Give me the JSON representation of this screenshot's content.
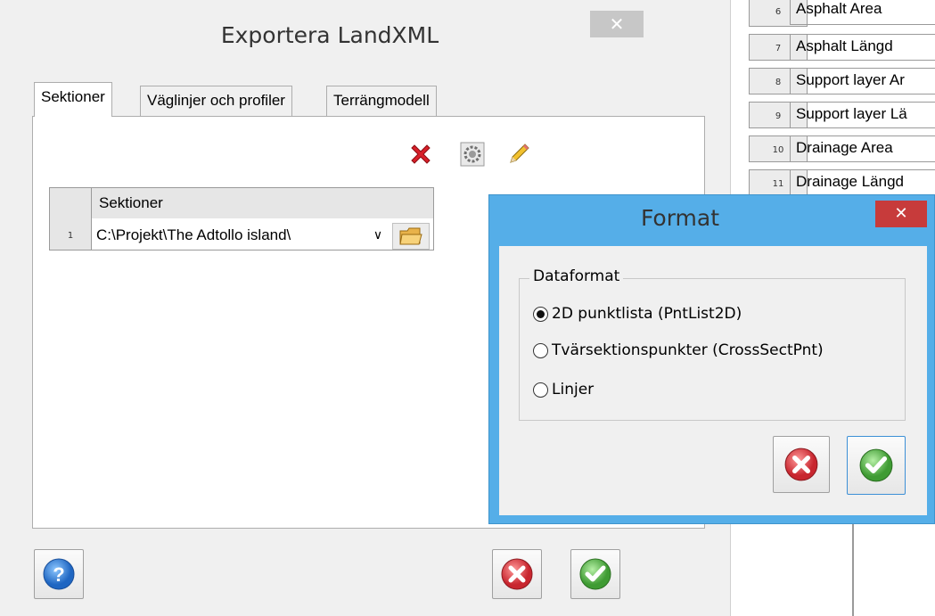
{
  "background_grid": {
    "rows": [
      {
        "num": "6",
        "text": "Asphalt Area"
      },
      {
        "num": "7",
        "text": "Asphalt Längd"
      },
      {
        "num": "8",
        "text": "Support layer Ar"
      },
      {
        "num": "9",
        "text": "Support layer Lä"
      },
      {
        "num": "10",
        "text": "Drainage Area"
      },
      {
        "num": "11",
        "text": "Drainage Längd"
      }
    ]
  },
  "main_dialog": {
    "title": "Exportera LandXML",
    "close_glyph": "✕",
    "tabs": [
      {
        "label": "Sektioner"
      },
      {
        "label": "Väglinjer och profiler"
      },
      {
        "label": "Terrängmodell"
      }
    ],
    "toolbar_icons": [
      "delete-icon",
      "settings-icon",
      "edit-icon"
    ],
    "grid": {
      "column_header": "Sektioner",
      "rows": [
        {
          "num": "1",
          "value": "C:\\Projekt\\The Adtollo island\\"
        }
      ],
      "dropdown_glyph": "∨"
    },
    "bottom_buttons": [
      "help-icon",
      "cancel-icon",
      "ok-icon"
    ]
  },
  "format_dialog": {
    "title": "Format",
    "close_glyph": "✕",
    "group_label": "Dataformat",
    "options": [
      {
        "label": "2D punktlista (PntList2D)",
        "selected": true
      },
      {
        "label": "Tvärsektionspunkter (CrossSectPnt)",
        "selected": false
      },
      {
        "label": "Linjer",
        "selected": false
      }
    ]
  },
  "colors": {
    "accent_blue": "#55aee8",
    "close_red": "#c73b3b",
    "cancel_red": "#d9434b",
    "ok_green": "#57b848"
  }
}
